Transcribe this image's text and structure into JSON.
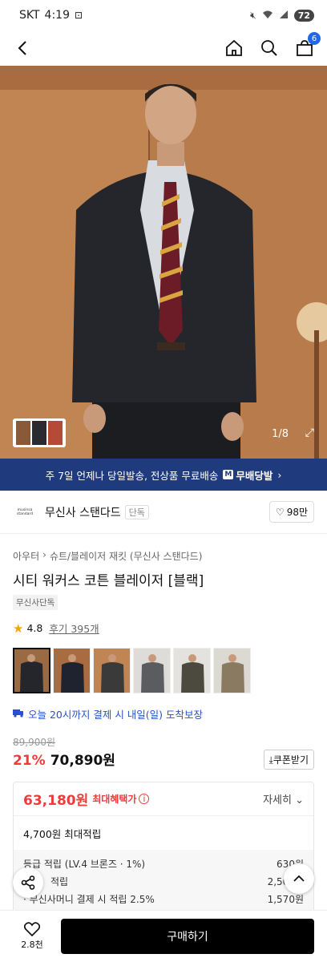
{
  "status_bar": {
    "carrier": "SKT",
    "time": "4:19",
    "battery": "72"
  },
  "nav": {
    "cart_count": "6"
  },
  "hero": {
    "counter": "1/8"
  },
  "banner": {
    "text": "주 7일 언제나 당일발송, 전상품 무료배송",
    "badge_text": "무배당발",
    "arrow": "›"
  },
  "brand": {
    "logo_text": "musinsa standard",
    "name": "무신사 스탠다드",
    "tag": "단독",
    "likes": "98만"
  },
  "breadcrumb": [
    "아우터",
    "›",
    "슈트/블레이저 재킷 (무신사 스탠다드)"
  ],
  "product": {
    "title": "시티 워커스 코튼 블레이저 [블랙]",
    "exclusive_tag": "무신사단독",
    "rating": "4.8",
    "review_text": "후기 395개",
    "arrival_text": "오늘 20시까지 결제 시 내일(일) 도착보장",
    "original_price": "89,900원",
    "discount": "21%",
    "price": "70,890원",
    "coupon_label": "쿠폰받기"
  },
  "benefit": {
    "max_price": "63,180원",
    "max_label": "최대혜택가",
    "detail_label": "자세히",
    "reward_total": "4,700원 최대적립",
    "rewards": [
      {
        "label": "등급 적립 (LV.4 브론즈 · 1%)",
        "value": "630원"
      },
      {
        "label": "적립",
        "value": "2,500원"
      },
      {
        "label": "· 무신사머니 결제 시 적립 2.5%",
        "value": "1,570원"
      }
    ]
  },
  "bottom": {
    "likes": "2.8천",
    "buy_label": "구매하기"
  },
  "colors": {
    "accent_blue": "#1f3a7d",
    "sale_red": "#ef3b3b",
    "link_blue": "#2a4fcf"
  }
}
